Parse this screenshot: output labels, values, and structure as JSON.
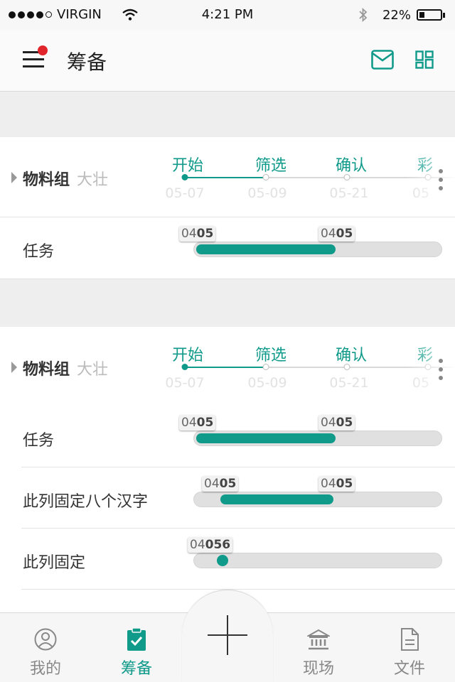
{
  "status_bar": {
    "carrier": "VIRGIN",
    "time": "4:21 PM",
    "battery": "22%",
    "battery_level": 0.22,
    "icons": [
      "signal-icon",
      "wifi-icon",
      "bluetooth-icon",
      "battery-icon"
    ]
  },
  "header": {
    "title": "筹备",
    "icons": [
      "menu-icon",
      "mail-icon",
      "grid-icon"
    ],
    "has_notification": true
  },
  "groups": [
    {
      "name": "物料组",
      "owner": "大壮",
      "stages": [
        {
          "label": "开始",
          "date": "05-07",
          "done": true
        },
        {
          "label": "筛选",
          "date": "05-09",
          "done": false
        },
        {
          "label": "确认",
          "date": "05-21",
          "done": false
        },
        {
          "label": "彩",
          "date": "05",
          "done": false
        }
      ],
      "tasks": [
        {
          "name": "任务",
          "start_tag": {
            "prefix": "04",
            "bold": "05"
          },
          "end_tag": {
            "prefix": "04",
            "bold": "05"
          },
          "progress_start": 0.0,
          "progress_end": 0.58
        }
      ]
    },
    {
      "name": "物料组",
      "owner": "大壮",
      "stages": [
        {
          "label": "开始",
          "date": "05-07",
          "done": true
        },
        {
          "label": "筛选",
          "date": "05-09",
          "done": false
        },
        {
          "label": "确认",
          "date": "05-21",
          "done": false
        },
        {
          "label": "彩",
          "date": "05",
          "done": false
        }
      ],
      "tasks": [
        {
          "name": "任务",
          "start_tag": {
            "prefix": "04",
            "bold": "05"
          },
          "end_tag": {
            "prefix": "04",
            "bold": "05"
          },
          "progress_start": 0.0,
          "progress_end": 0.58
        },
        {
          "name": "此列固定八个汉字",
          "start_tag": {
            "prefix": "04",
            "bold": "05"
          },
          "end_tag": {
            "prefix": "04",
            "bold": "05"
          },
          "progress_start": 0.1,
          "progress_end": 0.57
        },
        {
          "name": "此列固定",
          "start_tag": {
            "prefix": "04",
            "bold": "056"
          },
          "end_tag": null,
          "progress_start": 0.05,
          "progress_end": 0.05
        }
      ]
    }
  ],
  "tab_bar": {
    "tabs": [
      {
        "label": "我的",
        "icon": "user-icon",
        "active": false
      },
      {
        "label": "筹备",
        "icon": "clipboard-check-icon",
        "active": true
      },
      {
        "label": "",
        "icon": "add-icon",
        "active": false
      },
      {
        "label": "现场",
        "icon": "bank-icon",
        "active": false
      },
      {
        "label": "文件",
        "icon": "document-icon",
        "active": false
      }
    ]
  },
  "colors": {
    "accent": "#0f9a8a",
    "notification": "#e0262b",
    "band": "#eeeeee"
  }
}
